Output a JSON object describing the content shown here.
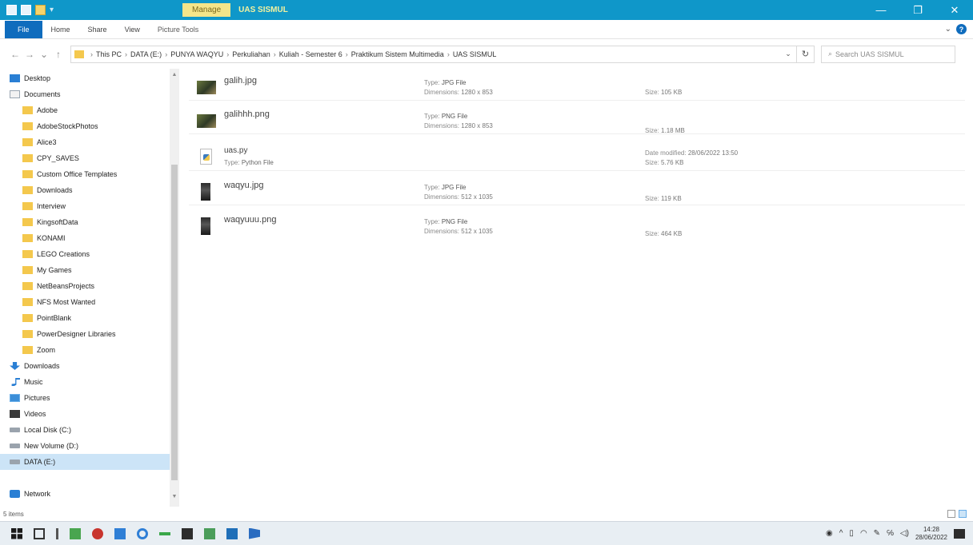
{
  "titlebar": {
    "manage_label": "Manage",
    "title": "UAS SISMUL",
    "minimize": "—",
    "maximize": "❐",
    "close": "✕"
  },
  "ribbon": {
    "tabs": [
      "File",
      "Home",
      "Share",
      "View",
      "Picture Tools"
    ],
    "help": "?"
  },
  "address": {
    "breadcrumb": [
      "This PC",
      "DATA (E:)",
      "PUNYA WAQYU",
      "Perkuliahan",
      "Kuliah - Semester 6",
      "Praktikum Sistem Multimedia",
      "UAS SISMUL"
    ],
    "search_placeholder": "Search UAS SISMUL"
  },
  "nav": {
    "items": [
      {
        "label": "Desktop",
        "icon": "desktop-icon"
      },
      {
        "label": "Documents",
        "icon": "documents-icon"
      },
      {
        "label": "Adobe",
        "icon": "folder-icon"
      },
      {
        "label": "AdobeStockPhotos",
        "icon": "folder-icon"
      },
      {
        "label": "Alice3",
        "icon": "folder-icon"
      },
      {
        "label": "CPY_SAVES",
        "icon": "folder-icon"
      },
      {
        "label": "Custom Office Templates",
        "icon": "folder-icon"
      },
      {
        "label": "Downloads",
        "icon": "folder-icon"
      },
      {
        "label": "Interview",
        "icon": "folder-icon"
      },
      {
        "label": "KingsoftData",
        "icon": "folder-icon"
      },
      {
        "label": "KONAMI",
        "icon": "folder-icon"
      },
      {
        "label": "LEGO Creations",
        "icon": "folder-icon"
      },
      {
        "label": "My Games",
        "icon": "folder-icon"
      },
      {
        "label": "NetBeansProjects",
        "icon": "folder-icon"
      },
      {
        "label": "NFS Most Wanted",
        "icon": "folder-icon"
      },
      {
        "label": "PointBlank",
        "icon": "folder-icon"
      },
      {
        "label": "PowerDesigner Libraries",
        "icon": "folder-icon"
      },
      {
        "label": "Zoom",
        "icon": "folder-icon"
      },
      {
        "label": "Downloads",
        "icon": "downloads-icon"
      },
      {
        "label": "Music",
        "icon": "music-icon"
      },
      {
        "label": "Pictures",
        "icon": "pictures-icon"
      },
      {
        "label": "Videos",
        "icon": "videos-icon"
      },
      {
        "label": "Local Disk (C:)",
        "icon": "drive-icon"
      },
      {
        "label": "New Volume (D:)",
        "icon": "drive-icon"
      },
      {
        "label": "DATA (E:)",
        "icon": "drive-icon"
      },
      {
        "label": "Network",
        "icon": "network-icon"
      }
    ],
    "selected": "DATA (E:)"
  },
  "labels": {
    "type": "Type:",
    "dimensions": "Dimensions:",
    "size": "Size:",
    "date_modified": "Date modified:"
  },
  "files": [
    {
      "name": "galih.jpg",
      "type": "JPG File",
      "dimensions": "1280 x 853",
      "size": "105 KB",
      "thumb": "photo"
    },
    {
      "name": "galihhh.png",
      "type": "PNG File",
      "dimensions": "1280 x 853",
      "size": "1.18 MB",
      "thumb": "photo"
    },
    {
      "name": "uas.py",
      "type": "Python File",
      "date_modified": "28/06/2022 13:50",
      "size": "5.76 KB",
      "thumb": "python"
    },
    {
      "name": "waqyu.jpg",
      "type": "JPG File",
      "dimensions": "512 x 1035",
      "size": "119 KB",
      "thumb": "portrait"
    },
    {
      "name": "waqyuuu.png",
      "type": "PNG File",
      "dimensions": "512 x 1035",
      "size": "464 KB",
      "thumb": "portrait"
    }
  ],
  "status": {
    "items_count": "5 items"
  },
  "taskbar": {
    "time": "14:28",
    "date": "28/06/2022"
  },
  "colors": {
    "titlebar": "#0f97c9",
    "manage_tab": "#f5e58a",
    "file_tab": "#0f6cbd",
    "selection": "#cce4f7"
  }
}
